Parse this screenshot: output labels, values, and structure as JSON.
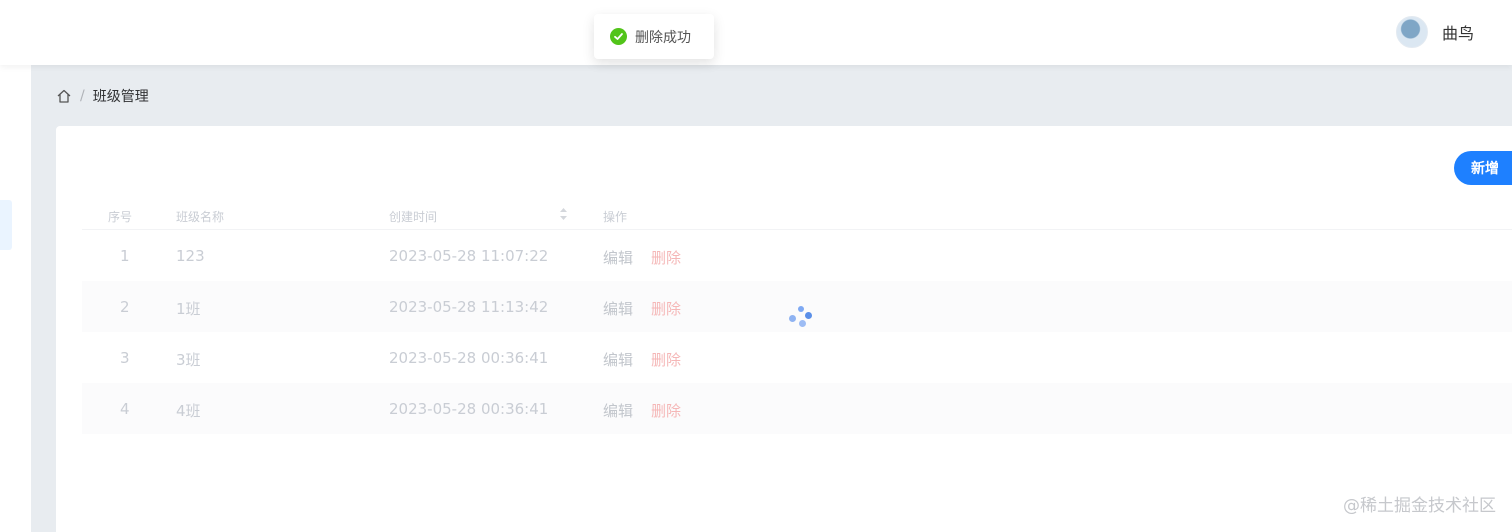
{
  "header": {
    "username": "曲鸟"
  },
  "breadcrumb": {
    "separator": "/",
    "current": "班级管理"
  },
  "toolbar": {
    "add_label": "新增"
  },
  "table": {
    "columns": [
      "序号",
      "班级名称",
      "创建时间",
      "操作"
    ],
    "rows": [
      {
        "index": "1",
        "name": "123",
        "created": "2023-05-28 11:07:22"
      },
      {
        "index": "2",
        "name": "1班",
        "created": "2023-05-28 11:13:42"
      },
      {
        "index": "3",
        "name": "3班",
        "created": "2023-05-28 00:36:41"
      },
      {
        "index": "4",
        "name": "4班",
        "created": "2023-05-28 00:36:41"
      }
    ],
    "actions": {
      "edit": "编辑",
      "delete": "删除"
    }
  },
  "toast": {
    "message": "删除成功",
    "icon": "success-check-icon",
    "color": "#52c41a"
  },
  "watermark": "@稀土掘金技术社区",
  "colors": {
    "primary": "#1e80ff",
    "danger": "#f56c6c"
  }
}
